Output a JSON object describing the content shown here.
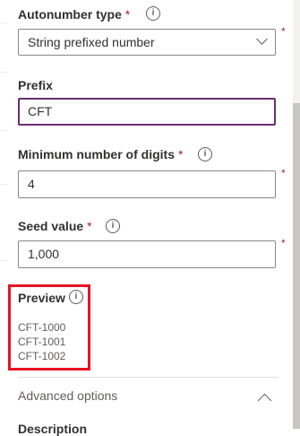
{
  "autonumber_type": {
    "label": "Autonumber type",
    "required_mark": "*",
    "value": "String prefixed number",
    "side_required_mark": "*"
  },
  "prefix": {
    "label": "Prefix",
    "value": "CFT"
  },
  "min_digits": {
    "label": "Minimum number of digits",
    "required_mark": "*",
    "value": "4",
    "side_required_mark": "*"
  },
  "seed_value": {
    "label": "Seed value",
    "required_mark": "*",
    "value": "1,000",
    "side_required_mark": "*"
  },
  "preview": {
    "label": "Preview",
    "items": [
      "CFT-1000",
      "CFT-1001",
      "CFT-1002"
    ]
  },
  "advanced_options": {
    "label": "Advanced options"
  },
  "description": {
    "label": "Description"
  },
  "icons": {
    "info": "i"
  },
  "colors": {
    "accent_focus": "#6b2e73",
    "required": "#a4262c",
    "highlight": "#e81123"
  }
}
